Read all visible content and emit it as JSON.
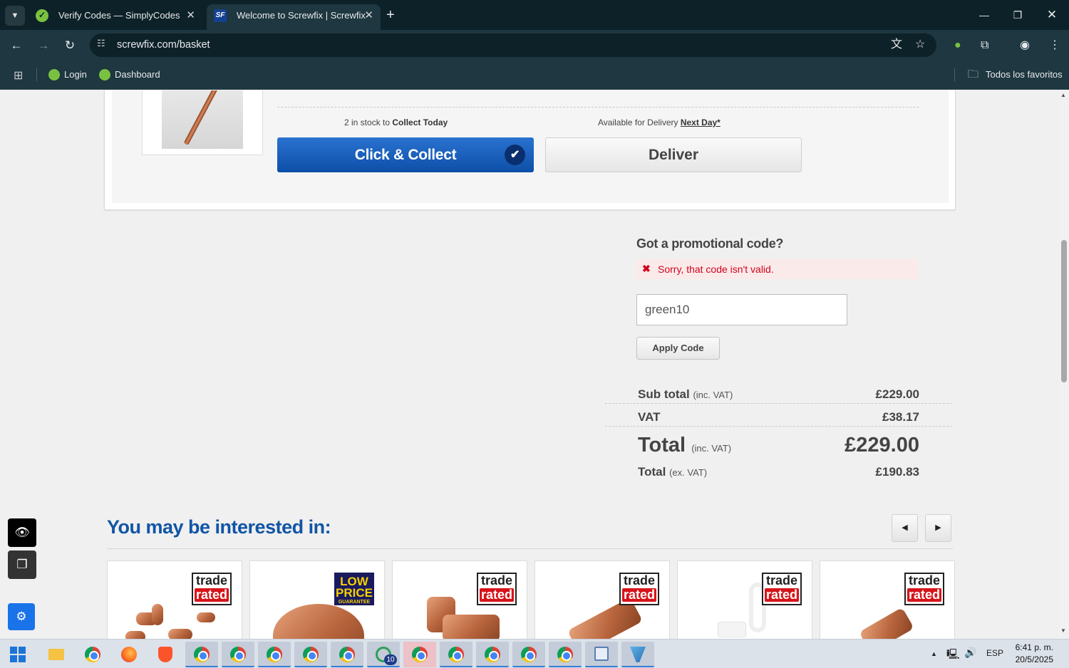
{
  "browser": {
    "tabs": [
      {
        "title": "Verify Codes — SimplyCodes",
        "active": false
      },
      {
        "title": "Welcome to Screwfix | Screwfix",
        "active": true
      }
    ],
    "url": "screwfix.com/basket",
    "bookmarks": [
      "Login",
      "Dashboard"
    ],
    "all_bookmarks_label": "Todos los favoritos"
  },
  "basket_item": {
    "collect_stock_prefix": "2 in stock to ",
    "collect_stock_bold": "Collect Today",
    "delivery_prefix": "Available for Delivery ",
    "delivery_link": "Next Day*",
    "collect_button": "Click & Collect",
    "deliver_button": "Deliver"
  },
  "promo": {
    "title": "Got a promotional code?",
    "error": "Sorry, that code isn't valid.",
    "input_value": "green10",
    "apply_button": "Apply Code"
  },
  "totals": {
    "subtotal_label": "Sub total",
    "subtotal_note": "(inc. VAT)",
    "subtotal_value": "£229.00",
    "vat_label": "VAT",
    "vat_value": "£38.17",
    "total_label": "Total",
    "total_note": "(inc. VAT)",
    "total_value": "£229.00",
    "total_ex_label": "Total",
    "total_ex_note": "(ex. VAT)",
    "total_ex_value": "£190.83"
  },
  "recommendations": {
    "title": "You may be interested in:",
    "badges": [
      "trade rated",
      "LOW PRICE GUARANTEE",
      "trade rated",
      "trade rated",
      "trade rated",
      "trade rated"
    ],
    "badge_trade_top": "trade",
    "badge_trade_bottom": "rated",
    "badge_lpg_top": "LOW",
    "badge_lpg_mid": "PRICE",
    "badge_lpg_bottom": "GUARANTEE"
  },
  "taskbar": {
    "language": "ESP",
    "time": "6:41 p. m.",
    "date": "20/5/2025",
    "badge_count": "10"
  },
  "colors": {
    "chrome_dark": "#0d2128",
    "chrome_mid": "#1e3740",
    "screwfix_blue": "#1155a5",
    "error_red": "#d0021b"
  }
}
